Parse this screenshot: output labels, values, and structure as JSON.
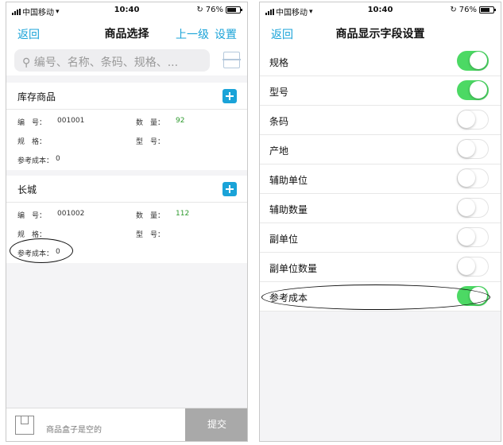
{
  "status": {
    "carrier": "中国移动",
    "time": "10:40",
    "battery": "76%"
  },
  "left": {
    "nav": {
      "back": "返回",
      "title": "商品选择",
      "up": "上一级",
      "settings": "设置"
    },
    "search_placeholder": "编号、名称、条码、规格、...",
    "groups": [
      {
        "name": "库存商品",
        "code_label": "编　号：",
        "code": "001001",
        "qty_label": "数　量：",
        "qty": "92",
        "spec_label": "规　格：",
        "model_label": "型　号：",
        "cost_label": "参考成本：",
        "cost": "0"
      },
      {
        "name": "长城",
        "code_label": "编　号：",
        "code": "001002",
        "qty_label": "数　量：",
        "qty": "112",
        "spec_label": "规　格：",
        "model_label": "型　号：",
        "cost_label": "参考成本：",
        "cost": "0"
      }
    ],
    "footer": {
      "empty_text": "商品盒子是空的",
      "submit": "提交"
    }
  },
  "right": {
    "nav": {
      "back": "返回",
      "title": "商品显示字段设置"
    },
    "fields": [
      {
        "label": "规格",
        "on": true
      },
      {
        "label": "型号",
        "on": true
      },
      {
        "label": "条码",
        "on": false
      },
      {
        "label": "产地",
        "on": false
      },
      {
        "label": "辅助单位",
        "on": false
      },
      {
        "label": "辅助数量",
        "on": false
      },
      {
        "label": "副单位",
        "on": false
      },
      {
        "label": "副单位数量",
        "on": false
      },
      {
        "label": "参考成本",
        "on": true
      }
    ]
  },
  "colors": {
    "accent": "#1aa3d8",
    "toggle_on": "#4cd964",
    "qty_green": "#2e9a2e"
  }
}
